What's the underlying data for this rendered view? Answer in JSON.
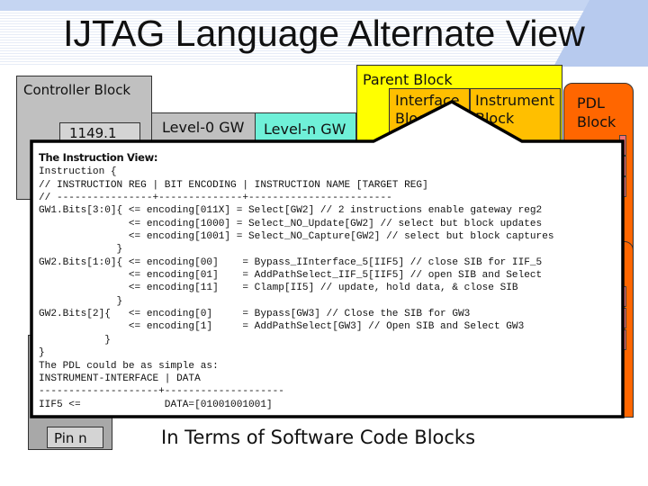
{
  "slide": {
    "title": "IJTAG Language Alternate View",
    "subtitle": "In Terms of Software Code Blocks"
  },
  "diagram": {
    "controller_block": "Controller Block",
    "tap_box": "1149.1",
    "level0_gw": "Level-0 GW",
    "leveln_gw": "Level-n GW",
    "parent_block": "Parent Block",
    "interface_block_line1": "Interface",
    "interface_block_line2": "Block",
    "instrument_block_line1": "Instrument",
    "instrument_block_line2": "Block",
    "pdl_block_line1": "PDL",
    "pdl_block_line2": "Block",
    "pin_n": "Pin n"
  },
  "colors": {
    "controller": "#c0c0c0",
    "leveln_gw": "#6ff0d8",
    "parent_block": "#ffff00",
    "interface_instrument": "#ffbf00",
    "pdl_block": "#ff6600",
    "header_band": "#c5d5f2"
  },
  "callout": {
    "heading": "The Instruction View:",
    "lines": [
      "Instruction {",
      "// INSTRUCTION REG | BIT ENCODING | INSTRUCTION NAME [TARGET REG]",
      "// ----------------+--------------+------------------------",
      "GW1.Bits[3:0]{ <= encoding[011X] = Select[GW2] // 2 instructions enable gateway reg2",
      "               <= encoding[1000] = Select_NO_Update[GW2] // select but block updates",
      "               <= encoding[1001] = Select_NO_Capture[GW2] // select but block captures",
      "             }",
      "GW2.Bits[1:0]{ <= encoding[00]    = Bypass_IInterface_5[IIF5] // close SIB for IIF_5",
      "               <= encoding[01]    = AddPathSelect_IIF_5[IIF5] // open SIB and Select",
      "               <= encoding[11]    = Clamp[II5] // update, hold data, & close SIB",
      "             }",
      "GW2.Bits[2]{   <= encoding[0]     = Bypass[GW3] // Close the SIB for GW3",
      "               <= encoding[1]     = AddPathSelect[GW3] // Open SIB and Select GW3",
      "           }",
      "}",
      "The PDL could be as simple as:",
      "INSTRUMENT-INTERFACE | DATA",
      "--------------------+--------------------",
      "IIF5 <=              DATA=[01001001001]"
    ]
  }
}
